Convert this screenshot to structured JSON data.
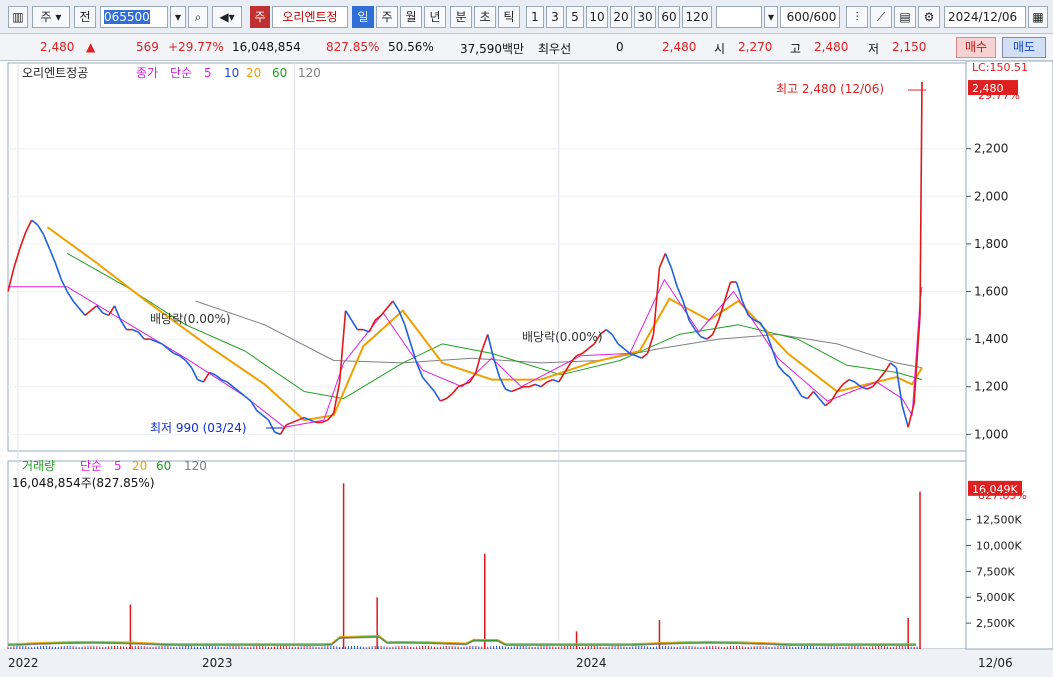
{
  "toolbar": {
    "type_label": "주",
    "prev_label": "전",
    "code": "065500",
    "zu_badge": "주",
    "stock_name": "오리엔트정",
    "periods": [
      "일",
      "주",
      "월",
      "년",
      "분",
      "초",
      "틱"
    ],
    "active_period": "일",
    "intervals": [
      "1",
      "3",
      "5",
      "10",
      "20",
      "30",
      "60",
      "120"
    ],
    "count": "600",
    "count_total": "/600",
    "date": "2024/12/06"
  },
  "quote": {
    "price": "2,480",
    "change": "569",
    "change_pct": "+29.77%",
    "volume": "16,048,854",
    "volume_ratio": "827.85%",
    "rate2": "50.56%",
    "amount": "37,590백만",
    "priority_label": "최우선",
    "priority_value": "0",
    "priority_price": "2,480",
    "open_label": "시",
    "open": "2,270",
    "high_label": "고",
    "high": "2,480",
    "low_label": "저",
    "low": "2,150",
    "buy_label": "매수",
    "sell_label": "매도"
  },
  "chart_data": {
    "type": "line",
    "title": "오리엔트정공",
    "legend": {
      "price_label": "종가",
      "ma_type": "단순",
      "ma_periods": [
        "5",
        "10",
        "20",
        "60",
        "120"
      ],
      "ma_colors": [
        "#e020e0",
        "#2040e0",
        "#f0a000",
        "#20a020",
        "#808080"
      ]
    },
    "price_series_color": "#e01818",
    "price_series_color2": "#2060e0",
    "x_labels": [
      "2022",
      "2023",
      "2024",
      "12/06"
    ],
    "y_ticks": [
      1000,
      1200,
      1400,
      1600,
      1800,
      2000,
      2200
    ],
    "ylim": [
      930,
      2560
    ],
    "last_price_badge": "2,480",
    "last_change_badge": "29.77%",
    "lc_label": "LC:150.51",
    "annotations": {
      "high": "최고 2,480 (12/06)",
      "low": "최저 990 (03/24)",
      "dividend1": "배당락(0.00%)",
      "dividend2": "배당락(0.00%)"
    },
    "price_points": [
      [
        0,
        1600
      ],
      [
        6,
        1700
      ],
      [
        12,
        1780
      ],
      [
        18,
        1850
      ],
      [
        24,
        1900
      ],
      [
        30,
        1880
      ],
      [
        36,
        1840
      ],
      [
        42,
        1780
      ],
      [
        48,
        1720
      ],
      [
        54,
        1650
      ],
      [
        60,
        1600
      ],
      [
        66,
        1560
      ],
      [
        72,
        1530
      ],
      [
        78,
        1500
      ],
      [
        84,
        1520
      ],
      [
        90,
        1540
      ],
      [
        96,
        1510
      ],
      [
        102,
        1500
      ],
      [
        108,
        1540
      ],
      [
        114,
        1480
      ],
      [
        120,
        1440
      ],
      [
        126,
        1440
      ],
      [
        132,
        1430
      ],
      [
        138,
        1400
      ],
      [
        144,
        1400
      ],
      [
        150,
        1390
      ],
      [
        156,
        1380
      ],
      [
        162,
        1360
      ],
      [
        168,
        1340
      ],
      [
        174,
        1330
      ],
      [
        180,
        1310
      ],
      [
        186,
        1280
      ],
      [
        192,
        1230
      ],
      [
        198,
        1220
      ],
      [
        204,
        1260
      ],
      [
        210,
        1250
      ],
      [
        216,
        1230
      ],
      [
        222,
        1220
      ],
      [
        228,
        1200
      ],
      [
        234,
        1180
      ],
      [
        240,
        1160
      ],
      [
        246,
        1140
      ],
      [
        252,
        1100
      ],
      [
        258,
        1080
      ],
      [
        264,
        1060
      ],
      [
        270,
        1010
      ],
      [
        276,
        1000
      ],
      [
        282,
        1040
      ],
      [
        288,
        1050
      ],
      [
        294,
        1060
      ],
      [
        300,
        1070
      ],
      [
        306,
        1060
      ],
      [
        312,
        1050
      ],
      [
        318,
        1050
      ],
      [
        324,
        1060
      ],
      [
        330,
        1090
      ],
      [
        336,
        1220
      ],
      [
        342,
        1520
      ],
      [
        348,
        1480
      ],
      [
        354,
        1440
      ],
      [
        360,
        1440
      ],
      [
        366,
        1430
      ],
      [
        372,
        1480
      ],
      [
        378,
        1500
      ],
      [
        384,
        1530
      ],
      [
        390,
        1560
      ],
      [
        396,
        1520
      ],
      [
        402,
        1460
      ],
      [
        408,
        1380
      ],
      [
        414,
        1300
      ],
      [
        420,
        1240
      ],
      [
        426,
        1210
      ],
      [
        432,
        1180
      ],
      [
        438,
        1140
      ],
      [
        444,
        1150
      ],
      [
        450,
        1170
      ],
      [
        456,
        1200
      ],
      [
        462,
        1210
      ],
      [
        468,
        1220
      ],
      [
        474,
        1260
      ],
      [
        480,
        1350
      ],
      [
        486,
        1420
      ],
      [
        492,
        1320
      ],
      [
        498,
        1240
      ],
      [
        504,
        1190
      ],
      [
        510,
        1180
      ],
      [
        516,
        1190
      ],
      [
        522,
        1200
      ],
      [
        528,
        1200
      ],
      [
        534,
        1210
      ],
      [
        540,
        1200
      ],
      [
        546,
        1220
      ],
      [
        552,
        1230
      ],
      [
        558,
        1220
      ],
      [
        564,
        1260
      ],
      [
        570,
        1300
      ],
      [
        576,
        1330
      ],
      [
        582,
        1340
      ],
      [
        588,
        1360
      ],
      [
        594,
        1380
      ],
      [
        600,
        1420
      ],
      [
        606,
        1440
      ],
      [
        612,
        1420
      ],
      [
        618,
        1380
      ],
      [
        624,
        1360
      ],
      [
        630,
        1340
      ],
      [
        636,
        1330
      ],
      [
        642,
        1320
      ],
      [
        648,
        1340
      ],
      [
        654,
        1420
      ],
      [
        660,
        1700
      ],
      [
        666,
        1760
      ],
      [
        672,
        1700
      ],
      [
        678,
        1620
      ],
      [
        684,
        1560
      ],
      [
        690,
        1480
      ],
      [
        696,
        1440
      ],
      [
        702,
        1410
      ],
      [
        708,
        1400
      ],
      [
        714,
        1420
      ],
      [
        720,
        1480
      ],
      [
        726,
        1560
      ],
      [
        732,
        1640
      ],
      [
        738,
        1640
      ],
      [
        744,
        1560
      ],
      [
        750,
        1500
      ],
      [
        756,
        1480
      ],
      [
        762,
        1470
      ],
      [
        768,
        1430
      ],
      [
        774,
        1360
      ],
      [
        780,
        1290
      ],
      [
        786,
        1260
      ],
      [
        792,
        1240
      ],
      [
        798,
        1200
      ],
      [
        804,
        1160
      ],
      [
        810,
        1150
      ],
      [
        816,
        1180
      ],
      [
        822,
        1150
      ],
      [
        828,
        1120
      ],
      [
        834,
        1140
      ],
      [
        840,
        1180
      ],
      [
        846,
        1210
      ],
      [
        852,
        1230
      ],
      [
        858,
        1220
      ],
      [
        864,
        1200
      ],
      [
        870,
        1190
      ],
      [
        876,
        1200
      ],
      [
        882,
        1230
      ],
      [
        888,
        1260
      ],
      [
        894,
        1300
      ],
      [
        900,
        1280
      ],
      [
        906,
        1120
      ],
      [
        912,
        1030
      ],
      [
        918,
        1130
      ],
      [
        924,
        1500
      ],
      [
        926,
        2480
      ]
    ],
    "ma5_points": [
      [
        0,
        1620
      ],
      [
        60,
        1620
      ],
      [
        120,
        1470
      ],
      [
        180,
        1320
      ],
      [
        240,
        1160
      ],
      [
        280,
        1030
      ],
      [
        320,
        1060
      ],
      [
        340,
        1300
      ],
      [
        380,
        1510
      ],
      [
        420,
        1270
      ],
      [
        460,
        1200
      ],
      [
        490,
        1320
      ],
      [
        520,
        1200
      ],
      [
        580,
        1330
      ],
      [
        630,
        1340
      ],
      [
        665,
        1650
      ],
      [
        700,
        1430
      ],
      [
        735,
        1600
      ],
      [
        780,
        1320
      ],
      [
        830,
        1140
      ],
      [
        880,
        1220
      ],
      [
        906,
        1150
      ],
      [
        916,
        1080
      ],
      [
        924,
        1560
      ],
      [
        926,
        1620
      ]
    ],
    "ma20_points": [
      [
        40,
        1870
      ],
      [
        90,
        1720
      ],
      [
        140,
        1560
      ],
      [
        200,
        1380
      ],
      [
        260,
        1210
      ],
      [
        300,
        1060
      ],
      [
        330,
        1080
      ],
      [
        360,
        1370
      ],
      [
        400,
        1520
      ],
      [
        440,
        1300
      ],
      [
        490,
        1230
      ],
      [
        540,
        1230
      ],
      [
        590,
        1300
      ],
      [
        640,
        1350
      ],
      [
        670,
        1570
      ],
      [
        710,
        1480
      ],
      [
        740,
        1560
      ],
      [
        790,
        1340
      ],
      [
        840,
        1180
      ],
      [
        900,
        1240
      ],
      [
        916,
        1210
      ],
      [
        926,
        1280
      ]
    ],
    "ma60_points": [
      [
        60,
        1760
      ],
      [
        120,
        1620
      ],
      [
        180,
        1460
      ],
      [
        240,
        1350
      ],
      [
        300,
        1180
      ],
      [
        340,
        1150
      ],
      [
        400,
        1300
      ],
      [
        440,
        1380
      ],
      [
        490,
        1340
      ],
      [
        560,
        1250
      ],
      [
        620,
        1310
      ],
      [
        680,
        1420
      ],
      [
        740,
        1460
      ],
      [
        800,
        1400
      ],
      [
        850,
        1290
      ],
      [
        900,
        1260
      ],
      [
        926,
        1230
      ]
    ],
    "ma120_points": [
      [
        190,
        1560
      ],
      [
        260,
        1460
      ],
      [
        330,
        1310
      ],
      [
        400,
        1300
      ],
      [
        470,
        1320
      ],
      [
        540,
        1300
      ],
      [
        600,
        1310
      ],
      [
        660,
        1360
      ],
      [
        720,
        1400
      ],
      [
        780,
        1420
      ],
      [
        840,
        1380
      ],
      [
        900,
        1300
      ],
      [
        926,
        1280
      ]
    ],
    "volume": {
      "title": "거래량",
      "ma_type": "단순",
      "ma_periods": [
        "5",
        "20",
        "60",
        "120"
      ],
      "ma_colors": [
        "#e020e0",
        "#f0a000",
        "#20a020",
        "#808080"
      ],
      "summary": "16,048,854주(827.85%)",
      "last_badge": "16,049K",
      "last_ratio": "827.85%",
      "y_ticks_k": [
        2500,
        5000,
        7500,
        10000,
        12500
      ],
      "y_tick_labels": [
        "2,500K",
        "5,000K",
        "7,500K",
        "10,000K",
        "12,500K"
      ],
      "ylim_k": [
        0,
        17000
      ],
      "spikes_k": [
        [
          124,
          4300
        ],
        [
          340,
          16000
        ],
        [
          374,
          5000
        ],
        [
          483,
          9200
        ],
        [
          576,
          1700
        ],
        [
          660,
          2800
        ],
        [
          912,
          3000
        ],
        [
          924,
          15200
        ]
      ]
    }
  }
}
